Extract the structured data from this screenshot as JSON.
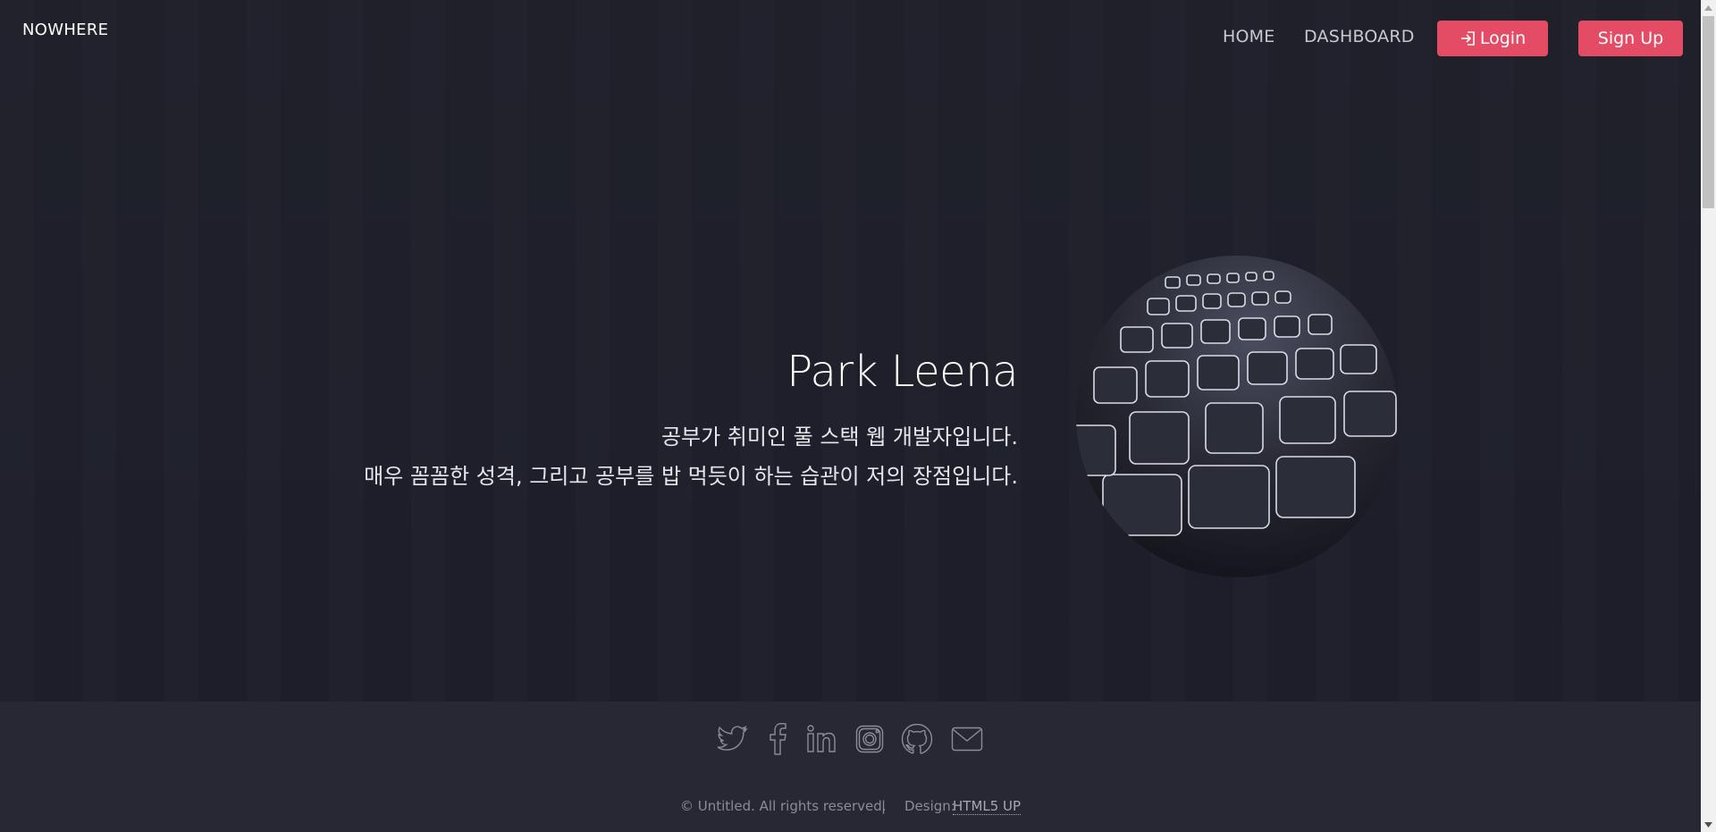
{
  "header": {
    "brand": "NOWHERE",
    "nav": [
      "HOME",
      "DASHBOARD"
    ],
    "login_label": "Login",
    "signup_label": "Sign Up",
    "login_icon": "sign-in-icon"
  },
  "hero": {
    "title": "Park Leena",
    "line1": "공부가 취미인 풀 스택 웹 개발자입니다.",
    "line2": "매우 꼼꼼한 성격, 그리고 공부를 밥 먹듯이 하는 습관이 저의 장점입니다.",
    "image": "keyboard-image"
  },
  "footer": {
    "social_icons": [
      "twitter-icon",
      "facebook-icon",
      "linkedin-icon",
      "instagram-icon",
      "github-icon",
      "email-icon"
    ],
    "copyright": "© Untitled. All rights reserved.",
    "separator": "|",
    "design_label": "Design:",
    "design_link": "HTML5 UP"
  },
  "colors": {
    "background": "#1d1e29",
    "footer_background": "#272833",
    "accent": "#e44c65",
    "icon_stroke": "#8a8c97"
  }
}
